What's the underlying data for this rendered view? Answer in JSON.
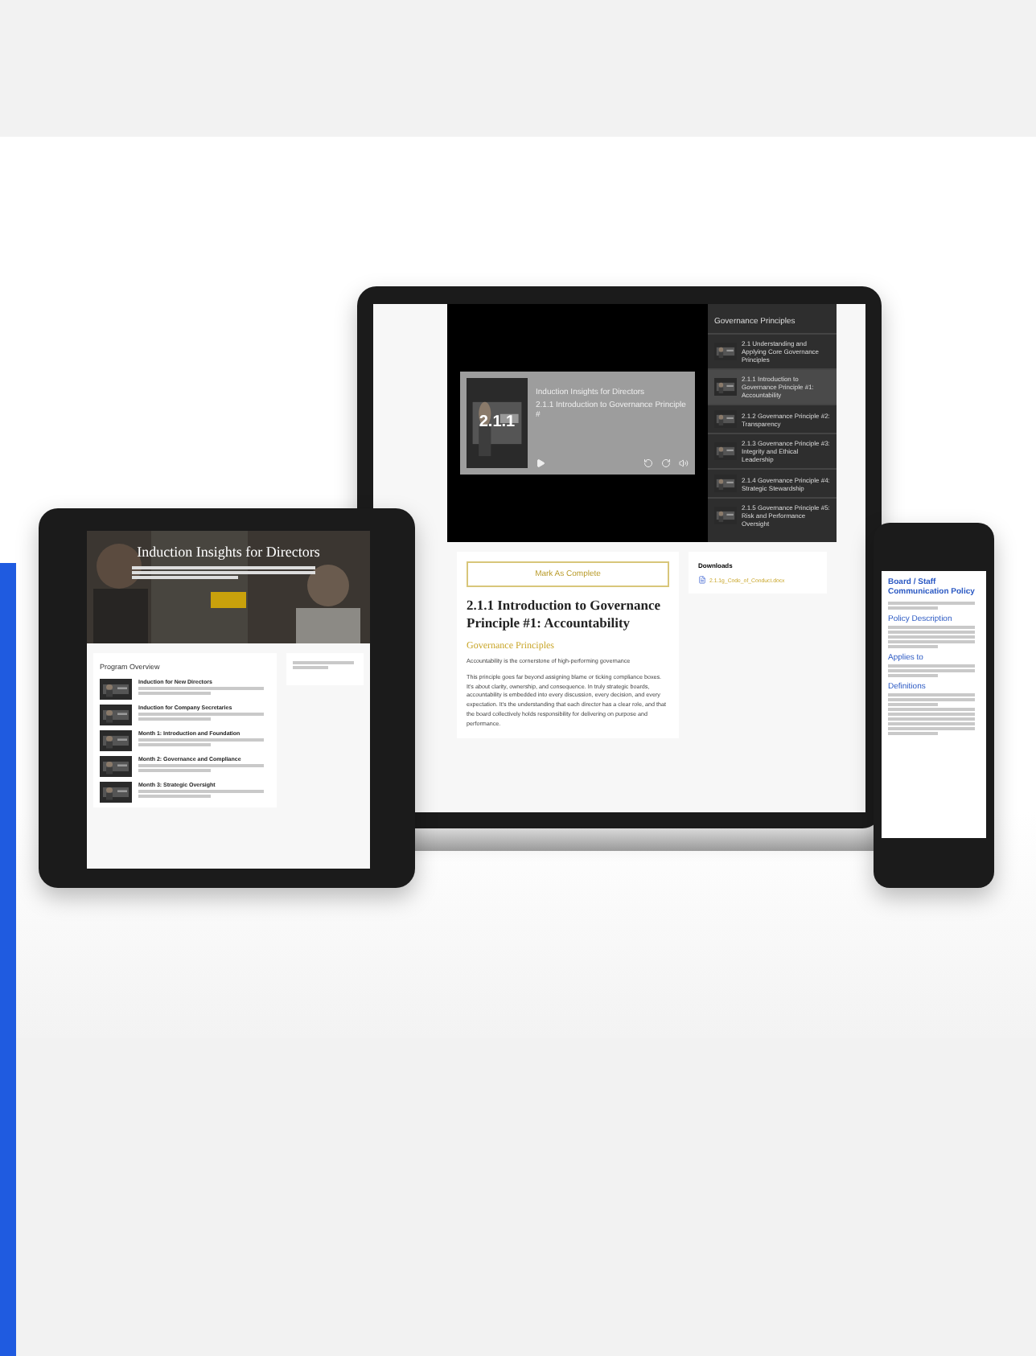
{
  "laptop": {
    "player": {
      "number": "2.1.1",
      "course": "Induction Insights for Directors",
      "lesson": "2.1.1 Introduction to Governance Principle #"
    },
    "playlist": {
      "title": "Governance Principles",
      "items": [
        {
          "label": "2.1 Understanding and Applying Core Governance Principles",
          "selected": false
        },
        {
          "label": "2.1.1 Introduction to Governance Principle #1: Accountability",
          "selected": true
        },
        {
          "label": "2.1.2 Governance Principle #2: Transparency",
          "selected": false
        },
        {
          "label": "2.1.3 Governance Principle #3: Integrity and Ethical Leadership",
          "selected": false
        },
        {
          "label": "2.1.4 Governance Principle #4: Strategic Stewardship",
          "selected": false
        },
        {
          "label": "2.1.5 Governance Principle #5: Risk and Performance Oversight",
          "selected": false
        }
      ]
    },
    "complete_button": "Mark As Complete",
    "heading": "2.1.1 Introduction to Governance Principle #1: Accountability",
    "subheading": "Governance Principles",
    "lead": "Accountability is the cornerstone of high-performing governance",
    "body": "This principle goes far beyond assigning blame or ticking compliance boxes. It's about clarity, ownership, and consequence. In truly strategic boards, accountability is embedded into every discussion, every decision, and every expectation. It's the understanding that each director has a clear role, and that the board collectively holds responsibility for delivering on purpose and performance.",
    "downloads": {
      "title": "Downloads",
      "files": [
        "2.1.1g_Code_of_Conduct.docx"
      ]
    }
  },
  "tablet": {
    "hero_title": "Induction Insights for Directors",
    "overview_title": "Program Overview",
    "modules": [
      {
        "title": "Induction for New Directors"
      },
      {
        "title": "Induction for Company Secretaries"
      },
      {
        "title": "Month 1: Introduction and Foundation"
      },
      {
        "title": "Month 2: Governance and Compliance"
      },
      {
        "title": "Month 3: Strategic Oversight"
      }
    ]
  },
  "phone": {
    "title": "Board / Staff Communication Policy",
    "sections": [
      "Policy Description",
      "Applies to",
      "Definitions"
    ]
  }
}
